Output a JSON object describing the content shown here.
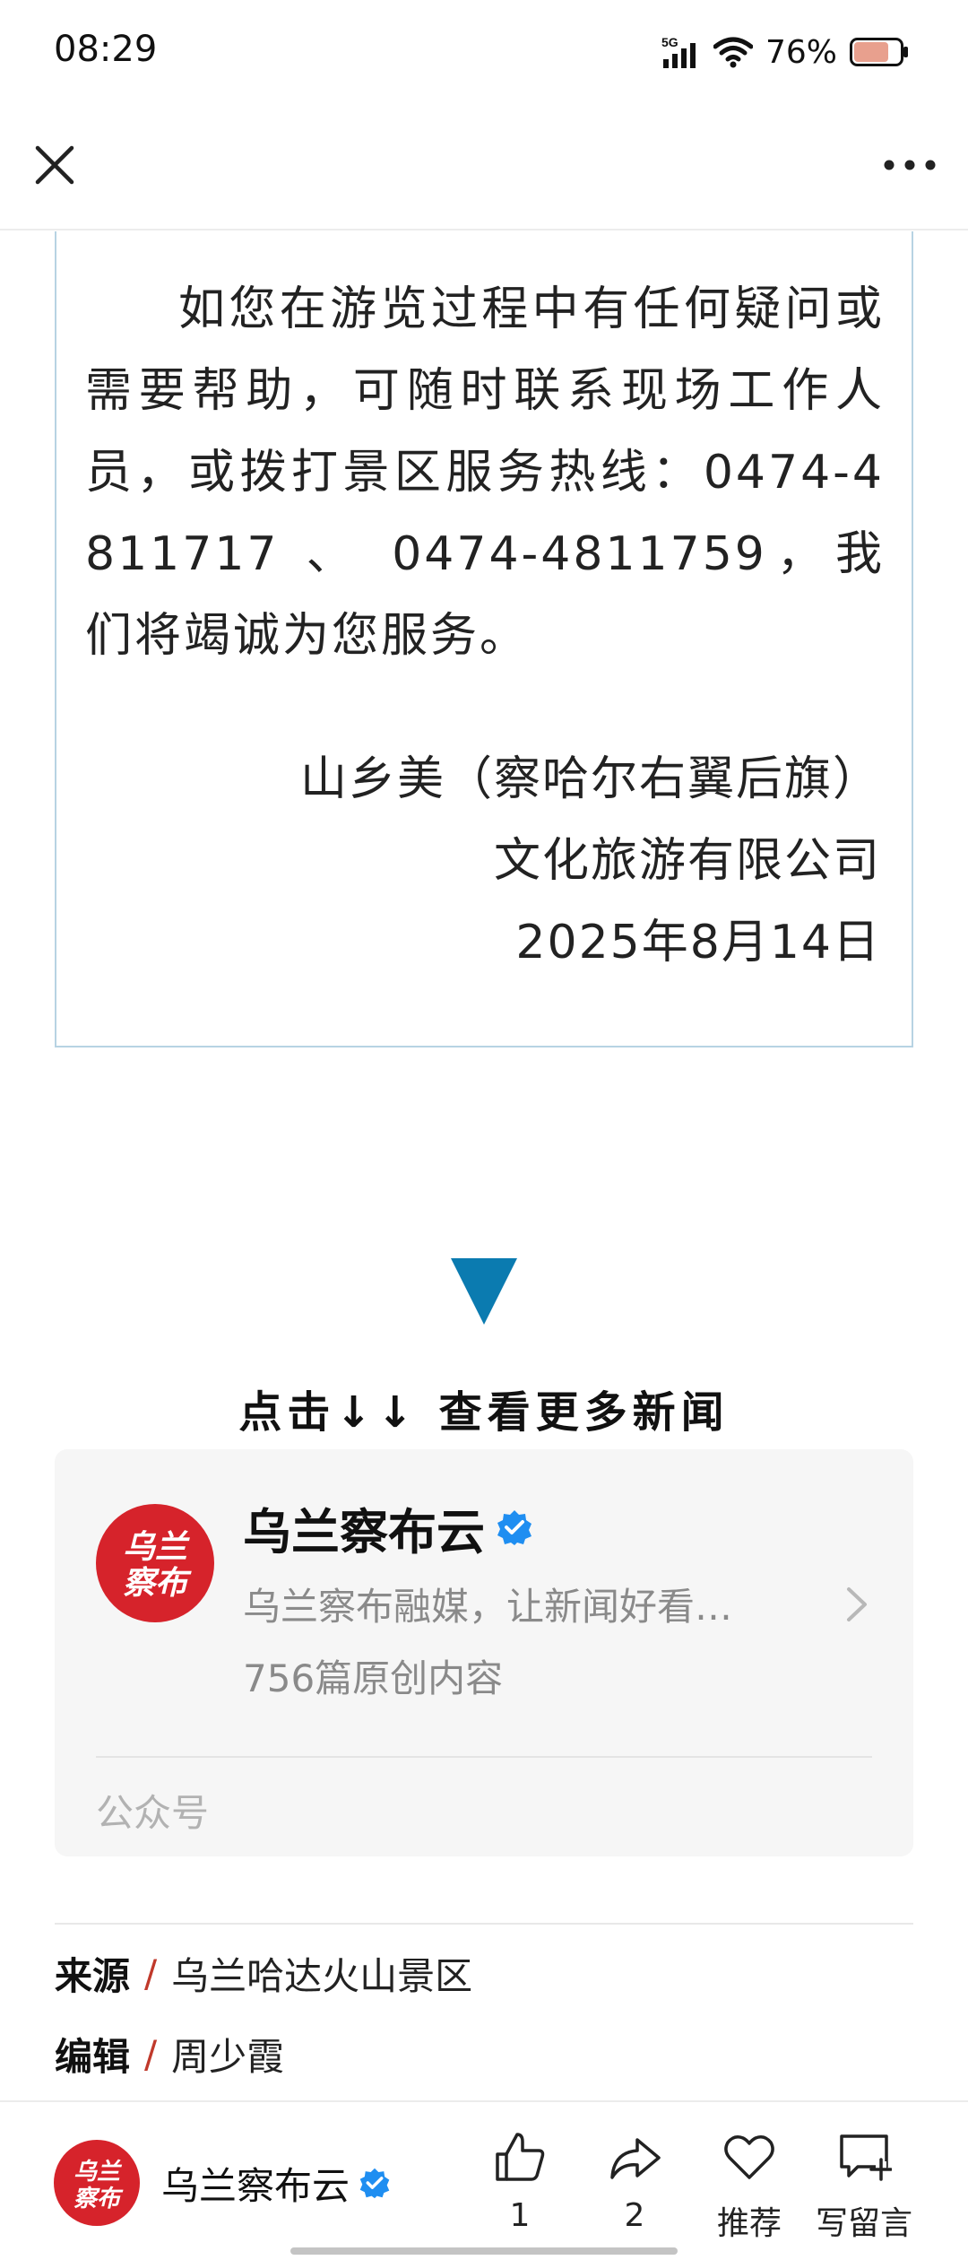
{
  "status_bar": {
    "time": "08:29",
    "network": "5G",
    "battery_percent": "76%",
    "battery_level": 0.76
  },
  "nav": {
    "close_icon": "close-icon",
    "more_icon": "more-icon"
  },
  "notice": {
    "body": "如您在游览过程中有任何疑问或需要帮助，可随时联系现场工作人员，或拨打景区服务热线：0474-4811717 、 0474-4811759，我们将竭诚为您服务。",
    "sign_line1": "山乡美（察哈尔右翼后旗）",
    "sign_line2": "文化旅游有限公司",
    "sign_date": "2025年8月14日"
  },
  "more_news": {
    "text": "点击↓↓ 查看更多新闻",
    "triangle_color": "#0b7bb0"
  },
  "account_card": {
    "logo_text_line1": "乌兰",
    "logo_text_line2": "察布",
    "name": "乌兰察布云",
    "verified_icon": "verified-badge-icon",
    "description": "乌兰察布融媒，让新闻好看…",
    "original_count": "756篇原创内容",
    "type_label": "公众号",
    "logo_color": "#d6232b",
    "verified_color": "#1f8ef1"
  },
  "meta": {
    "source_key": "来源",
    "source_value": "乌兰哈达火山景区",
    "editor_key": "编辑",
    "editor_value": "周少霞"
  },
  "bottom_bar": {
    "logo_text_line1": "乌兰",
    "logo_text_line2": "察布",
    "name": "乌兰察布云",
    "like_count": "1",
    "share_count": "2",
    "recommend_label": "推荐",
    "comment_label": "写留言"
  }
}
